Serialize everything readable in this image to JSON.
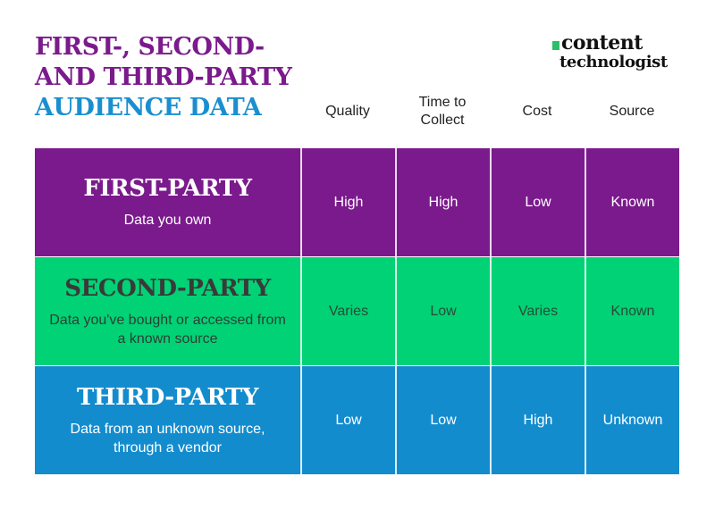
{
  "title": {
    "line1": "FIRST-, SECOND-",
    "line2": "AND THIRD-PARTY",
    "line3": "AUDIENCE DATA"
  },
  "logo": {
    "word1": "content",
    "word2": "technologist"
  },
  "columns": [
    "Quality",
    "Time to Collect",
    "Cost",
    "Source"
  ],
  "rows": [
    {
      "name": "FIRST-PARTY",
      "description": "Data you own",
      "values": [
        "High",
        "High",
        "Low",
        "Known"
      ],
      "color": "#7a1a8c"
    },
    {
      "name": "SECOND-PARTY",
      "description": "Data you've bought or accessed from a known source",
      "values": [
        "Varies",
        "Low",
        "Varies",
        "Known"
      ],
      "color": "#00d275"
    },
    {
      "name": "THIRD-PARTY",
      "description": "Data from an unknown source, through a vendor",
      "values": [
        "Low",
        "Low",
        "High",
        "Unknown"
      ],
      "color": "#138cce"
    }
  ]
}
